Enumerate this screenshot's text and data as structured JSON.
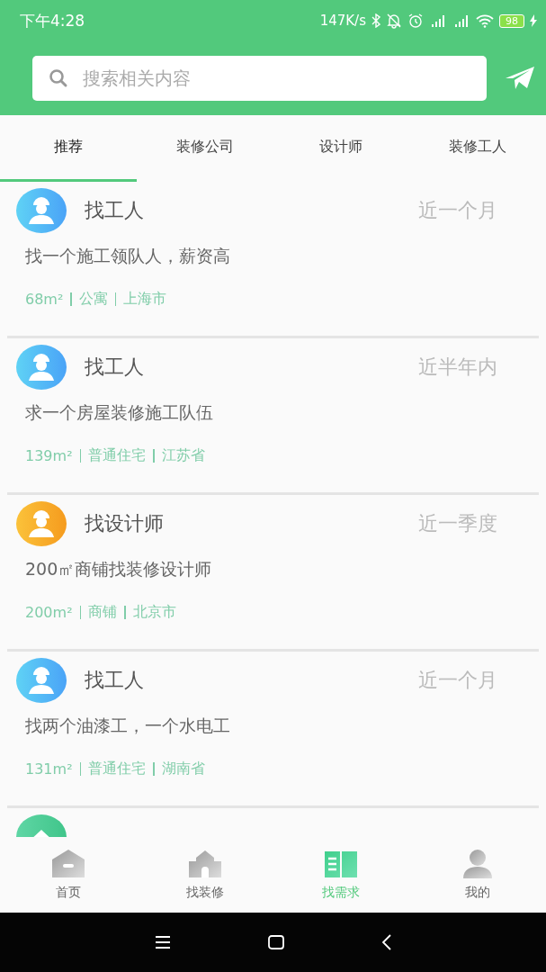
{
  "status_bar": {
    "time": "下午4:28",
    "speed": "147K/s",
    "battery": "98"
  },
  "search": {
    "placeholder": "搜索相关内容"
  },
  "tabs": [
    {
      "label": "推荐",
      "selected": true
    },
    {
      "label": "装修公司",
      "selected": false
    },
    {
      "label": "设计师",
      "selected": false
    },
    {
      "label": "装修工人",
      "selected": false
    }
  ],
  "posts": [
    {
      "kind": "worker",
      "title": "找工人",
      "time": "近一个月",
      "description": "找一个施工领队人，薪资高",
      "tags": [
        "68m²",
        "公寓",
        "上海市"
      ]
    },
    {
      "kind": "worker",
      "title": "找工人",
      "time": "近半年内",
      "description": "求一个房屋装修施工队伍",
      "tags": [
        "139m²",
        "普通住宅",
        "江苏省"
      ]
    },
    {
      "kind": "designer",
      "title": "找设计师",
      "time": "近一季度",
      "description": "200㎡商铺找装修设计师",
      "tags": [
        "200m²",
        "商铺",
        "北京市"
      ]
    },
    {
      "kind": "worker",
      "title": "找工人",
      "time": "近一个月",
      "description": "找两个油漆工，一个水电工",
      "tags": [
        "131m²",
        "普通住宅",
        "湖南省"
      ]
    },
    {
      "kind": "company"
    }
  ],
  "bottom_nav": [
    {
      "kind": "home",
      "label": "首页",
      "selected": false
    },
    {
      "kind": "decor",
      "label": "找装修",
      "selected": false
    },
    {
      "kind": "needs",
      "label": "找需求",
      "selected": true
    },
    {
      "kind": "me",
      "label": "我的",
      "selected": false
    }
  ]
}
